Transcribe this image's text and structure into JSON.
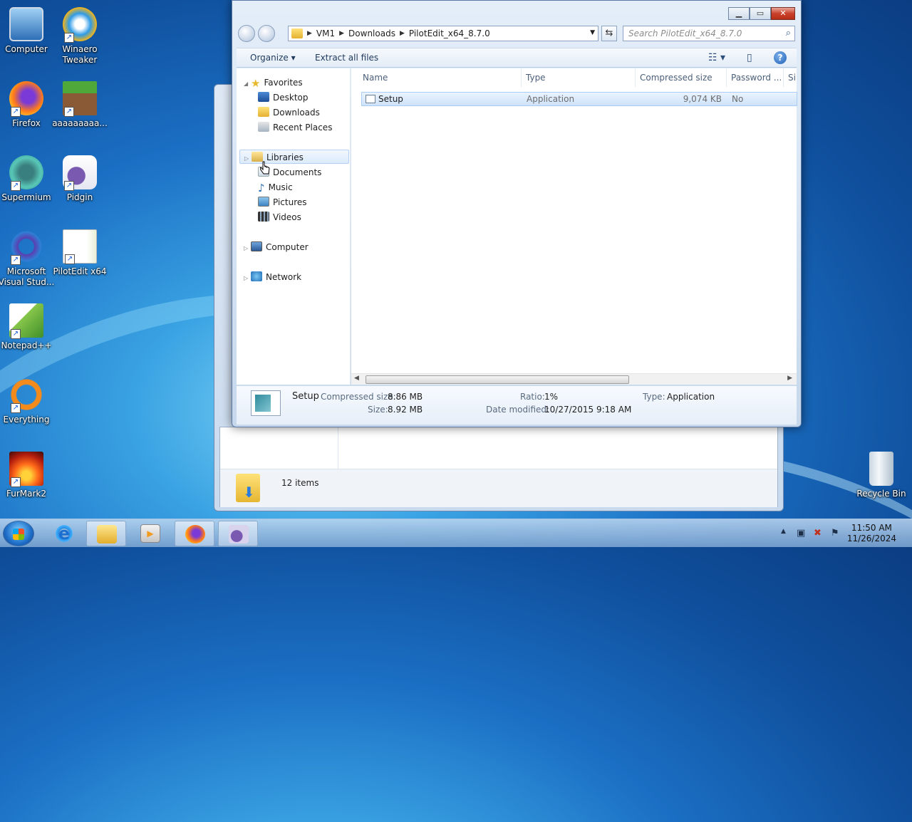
{
  "desktop": {
    "icons": [
      {
        "label": "Computer",
        "icon": "computer-icon"
      },
      {
        "label": "Winaero Tweaker",
        "icon": "winaero-icon"
      },
      {
        "label": "Firefox",
        "icon": "firefox-icon"
      },
      {
        "label": "aaaaaaaaa...",
        "icon": "minecraft-icon"
      },
      {
        "label": "Supermium",
        "icon": "supermium-icon"
      },
      {
        "label": "Pidgin",
        "icon": "pidgin-icon"
      },
      {
        "label": "Microsoft Visual Stud...",
        "icon": "visual-studio-icon"
      },
      {
        "label": "PilotEdit x64",
        "icon": "pilotedit-icon"
      },
      {
        "label": "Notepad++",
        "icon": "notepadpp-icon"
      },
      {
        "label": "Everything",
        "icon": "everything-icon"
      },
      {
        "label": "FurMark2",
        "icon": "furmark-icon"
      },
      {
        "label": "Recycle Bin",
        "icon": "recycle-bin-icon"
      }
    ]
  },
  "bg_window": {
    "status_text": "12 items"
  },
  "window": {
    "caption": {
      "minimize": "▁",
      "maximize": "▭",
      "close": "✕"
    },
    "address": {
      "crumbs": [
        "VM1",
        "Downloads",
        "PilotEdit_x64_8.7.0"
      ]
    },
    "search_placeholder": "Search PilotEdit_x64_8.7.0",
    "toolbar": {
      "organize": "Organize ▾",
      "extract_all": "Extract all files"
    },
    "nav": {
      "favorites": "Favorites",
      "desktop": "Desktop",
      "downloads": "Downloads",
      "recent_places": "Recent Places",
      "libraries": "Libraries",
      "documents": "Documents",
      "music": "Music",
      "pictures": "Pictures",
      "videos": "Videos",
      "computer": "Computer",
      "network": "Network"
    },
    "columns": {
      "name": "Name",
      "type": "Type",
      "compressed_size": "Compressed size",
      "password": "Password ...",
      "size_partial": "Si"
    },
    "files": [
      {
        "name": "Setup",
        "type": "Application",
        "compressed_size": "9,074 KB",
        "password": "No"
      }
    ],
    "details": {
      "name": "Setup",
      "compressed_size_label": "Compressed size:",
      "compressed_size": "8.86 MB",
      "size_label": "Size:",
      "size": "8.92 MB",
      "ratio_label": "Ratio:",
      "ratio": "1%",
      "date_label": "Date modified:",
      "date": "10/27/2015 9:18 AM",
      "type_label": "Type:",
      "type": "Application"
    }
  },
  "taskbar": {
    "time": "11:50 AM",
    "date": "11/26/2024"
  }
}
